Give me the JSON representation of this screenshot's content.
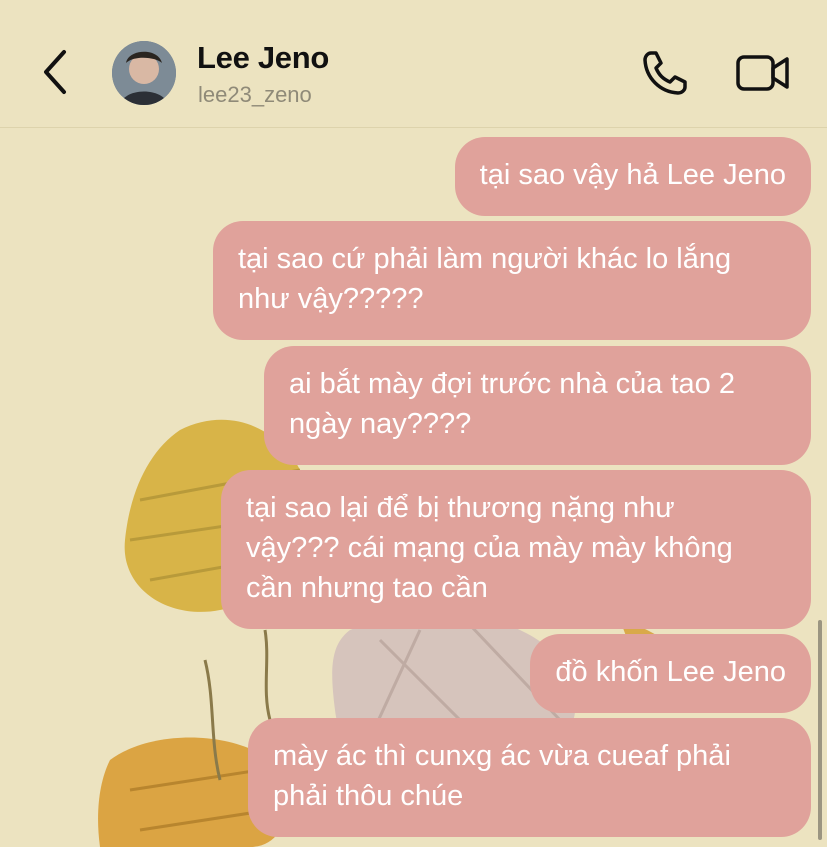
{
  "header": {
    "name": "Lee Jeno",
    "handle": "lee23_zeno",
    "back_icon": "chevron-left-icon",
    "call_icon": "phone-icon",
    "video_icon": "video-camera-icon"
  },
  "messages": [
    {
      "text": "tại sao vậy hả Lee Jeno"
    },
    {
      "text": "tại sao cứ phải làm người khác lo lắng\nnhư vậy?????"
    },
    {
      "text": "ai bắt mày đợi trước nhà của tao 2\nngày nay????"
    },
    {
      "text": "tại sao lại để bị thương nặng như\nvậy??? cái mạng của mày mày không\ncần nhưng tao cần"
    },
    {
      "text": "đồ khốn Lee Jeno"
    },
    {
      "text": "mày ác thì cunxg ác vừa cueaf phải\nphải thôu chúe"
    }
  ],
  "colors": {
    "background": "#ece3c0",
    "bubble": "#e0a29b",
    "bubble_text": "#ffffff"
  }
}
